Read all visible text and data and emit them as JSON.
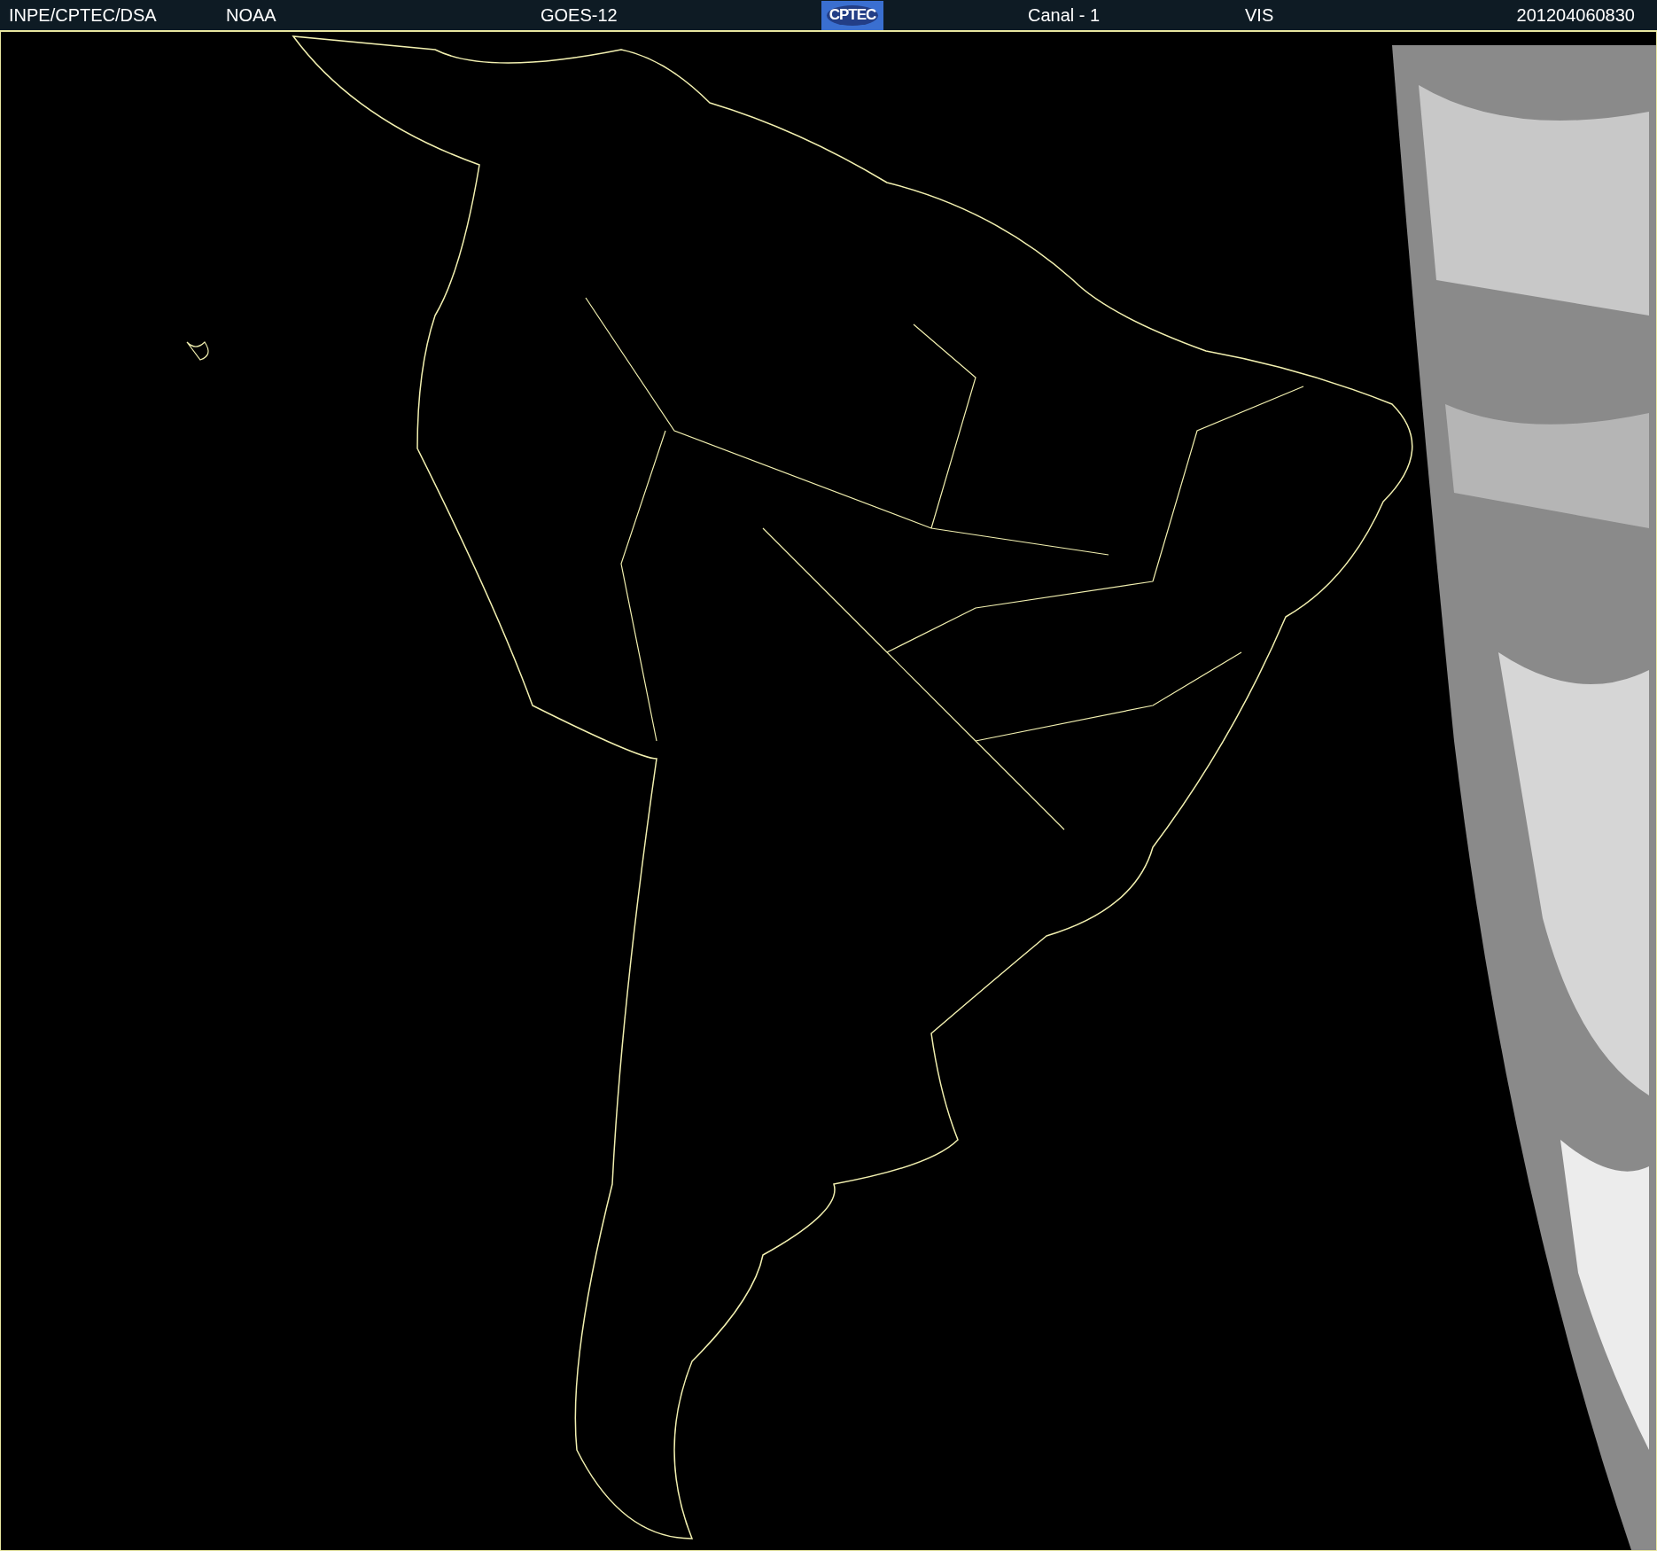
{
  "header": {
    "left_items": [
      "INPE/CPTEC/DSA",
      "NOAA",
      "GOES-12"
    ],
    "logo": "CPTEC",
    "right_items": [
      "Canal - 1",
      "VIS"
    ],
    "timestamp": "201204060830"
  }
}
